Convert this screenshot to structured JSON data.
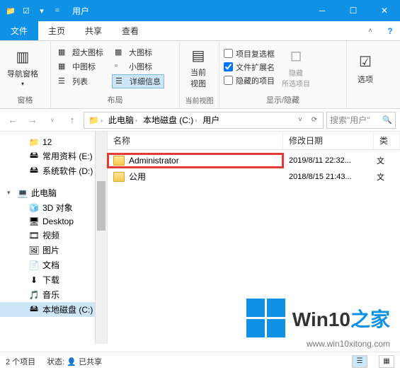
{
  "window": {
    "title": "用户"
  },
  "tabs": {
    "file": "文件",
    "home": "主页",
    "share": "共享",
    "view": "查看"
  },
  "ribbon": {
    "pane": {
      "nav": "导航窗格",
      "label": "窗格"
    },
    "layout": {
      "extra_large": "超大图标",
      "large": "大图标",
      "medium": "中图标",
      "small": "小图标",
      "list": "列表",
      "details": "详细信息",
      "label": "布局"
    },
    "current_view": {
      "btn": "当前\n视图",
      "label": "当前视图"
    },
    "showhide": {
      "chk_checkboxes": "项目复选框",
      "chk_extensions": "文件扩展名",
      "chk_hidden": "隐藏的项目",
      "hide": "隐藏\n所选项目",
      "label": "显示/隐藏"
    },
    "options": "选项"
  },
  "addressbar": {
    "crumbs": [
      "此电脑",
      "本地磁盘 (C:)",
      "用户"
    ],
    "search_placeholder": "搜索\"用户\""
  },
  "tree": {
    "items": [
      {
        "label": "12",
        "icon": "folder",
        "level": 1
      },
      {
        "label": "常用资料 (E:)",
        "icon": "drive",
        "level": 1
      },
      {
        "label": "系统软件 (D:)",
        "icon": "drive",
        "level": 1
      },
      {
        "label": "此电脑",
        "icon": "pc",
        "level": 0,
        "expanded": true
      },
      {
        "label": "3D 对象",
        "icon": "3d",
        "level": 1
      },
      {
        "label": "Desktop",
        "icon": "desktop",
        "level": 1
      },
      {
        "label": "视频",
        "icon": "video",
        "level": 1
      },
      {
        "label": "图片",
        "icon": "pictures",
        "level": 1
      },
      {
        "label": "文档",
        "icon": "docs",
        "level": 1
      },
      {
        "label": "下载",
        "icon": "downloads",
        "level": 1
      },
      {
        "label": "音乐",
        "icon": "music",
        "level": 1
      },
      {
        "label": "本地磁盘 (C:)",
        "icon": "drive",
        "level": 1,
        "selected": true
      }
    ]
  },
  "columns": {
    "name": "名称",
    "date": "修改日期",
    "type": "类"
  },
  "rows": [
    {
      "name": "Administrator",
      "date": "2019/8/11 22:32...",
      "type": "文",
      "highlight": true
    },
    {
      "name": "公用",
      "date": "2018/8/15 21:43...",
      "type": "文"
    }
  ],
  "status": {
    "count": "2 个项目",
    "state": "状态: ",
    "shared": "已共享"
  },
  "watermark": {
    "brand_a": "Win10",
    "brand_b": "之家",
    "url": "www.win10xitong.com"
  }
}
